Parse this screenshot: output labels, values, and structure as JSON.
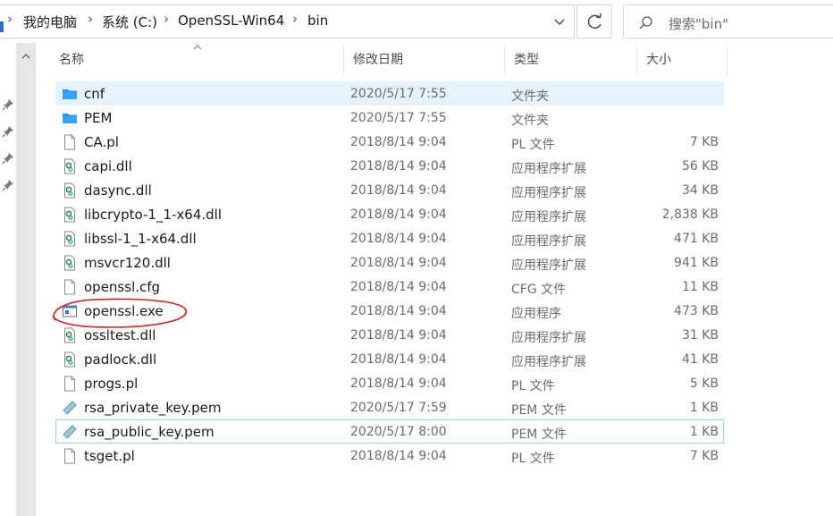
{
  "address": {
    "crumbs": [
      "我的电脑",
      "系统 (C:)",
      "OpenSSL-Win64",
      "bin"
    ]
  },
  "search": {
    "placeholder": "搜索\"bin\""
  },
  "columns": {
    "name": "名称",
    "date": "修改日期",
    "type": "类型",
    "size": "大小"
  },
  "files": [
    {
      "name": "cnf",
      "date": "2020/5/17 7:55",
      "type": "文件夹",
      "size": "",
      "icon": "folder-icon",
      "state": "selected"
    },
    {
      "name": "PEM",
      "date": "2020/5/17 7:55",
      "type": "文件夹",
      "size": "",
      "icon": "folder-icon",
      "state": ""
    },
    {
      "name": "CA.pl",
      "date": "2018/8/14 9:04",
      "type": "PL 文件",
      "size": "7 KB",
      "icon": "file-icon",
      "state": ""
    },
    {
      "name": "capi.dll",
      "date": "2018/8/14 9:04",
      "type": "应用程序扩展",
      "size": "56 KB",
      "icon": "dll-icon",
      "state": ""
    },
    {
      "name": "dasync.dll",
      "date": "2018/8/14 9:04",
      "type": "应用程序扩展",
      "size": "34 KB",
      "icon": "dll-icon",
      "state": ""
    },
    {
      "name": "libcrypto-1_1-x64.dll",
      "date": "2018/8/14 9:04",
      "type": "应用程序扩展",
      "size": "2,838 KB",
      "icon": "dll-icon",
      "state": ""
    },
    {
      "name": "libssl-1_1-x64.dll",
      "date": "2018/8/14 9:04",
      "type": "应用程序扩展",
      "size": "471 KB",
      "icon": "dll-icon",
      "state": ""
    },
    {
      "name": "msvcr120.dll",
      "date": "2018/8/14 9:04",
      "type": "应用程序扩展",
      "size": "941 KB",
      "icon": "dll-icon",
      "state": ""
    },
    {
      "name": "openssl.cfg",
      "date": "2018/8/14 9:04",
      "type": "CFG 文件",
      "size": "11 KB",
      "icon": "file-icon",
      "state": ""
    },
    {
      "name": "openssl.exe",
      "date": "2018/8/14 9:04",
      "type": "应用程序",
      "size": "473 KB",
      "icon": "exe-icon",
      "state": ""
    },
    {
      "name": "ossltest.dll",
      "date": "2018/8/14 9:04",
      "type": "应用程序扩展",
      "size": "31 KB",
      "icon": "dll-icon",
      "state": ""
    },
    {
      "name": "padlock.dll",
      "date": "2018/8/14 9:04",
      "type": "应用程序扩展",
      "size": "41 KB",
      "icon": "dll-icon",
      "state": ""
    },
    {
      "name": "progs.pl",
      "date": "2018/8/14 9:04",
      "type": "PL 文件",
      "size": "5 KB",
      "icon": "file-icon",
      "state": ""
    },
    {
      "name": "rsa_private_key.pem",
      "date": "2020/5/17 7:59",
      "type": "PEM 文件",
      "size": "1 KB",
      "icon": "pem-icon",
      "state": ""
    },
    {
      "name": "rsa_public_key.pem",
      "date": "2020/5/17 8:00",
      "type": "PEM 文件",
      "size": "1 KB",
      "icon": "pem-icon",
      "state": "focused"
    },
    {
      "name": "tsget.pl",
      "date": "2018/8/14 9:04",
      "type": "PL 文件",
      "size": "7 KB",
      "icon": "file-icon",
      "state": ""
    }
  ],
  "colors": {
    "folder": "#1e90ff",
    "selected_bg": "#e5f3ff",
    "focus_border": "#99d1ff",
    "annotation": "#d91818"
  }
}
